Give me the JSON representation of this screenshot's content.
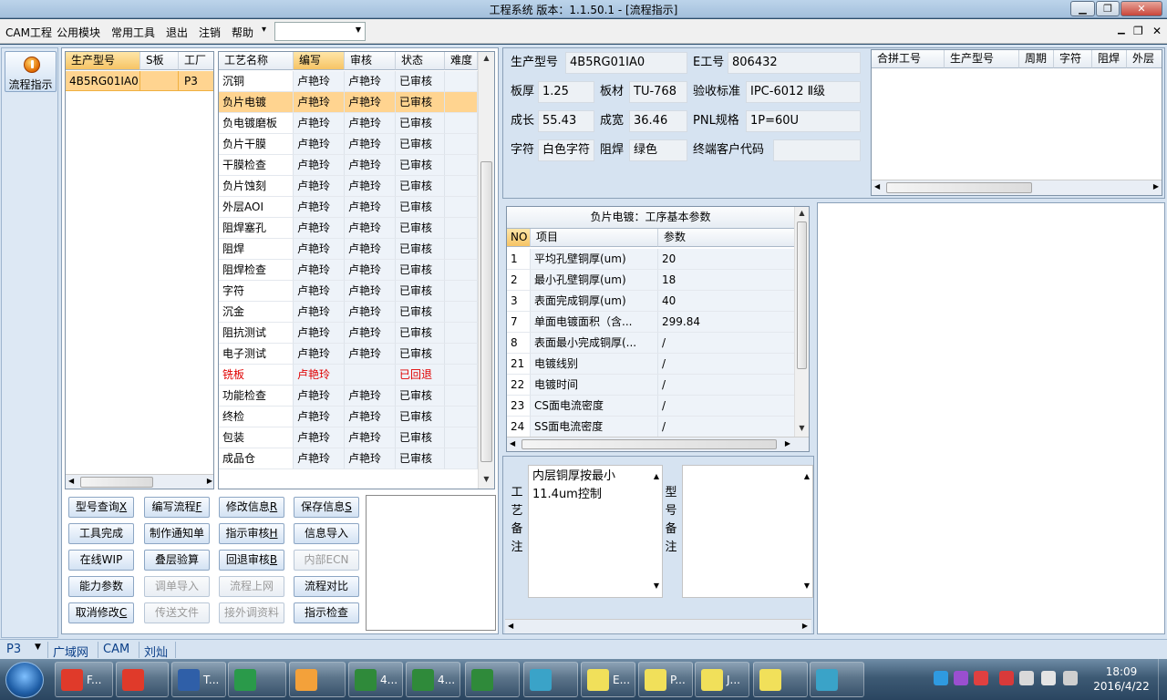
{
  "window": {
    "title": "工程系统   版本：1.1.50.1 - [流程指示]"
  },
  "menu": {
    "items": [
      "CAM工程",
      "公用模块",
      "常用工具",
      "退出",
      "注销",
      "帮助"
    ],
    "help_arrow": "▾",
    "combo_value": ""
  },
  "left_strip": {
    "flow_button": "流程指示"
  },
  "product_list": {
    "headers": [
      "生产型号",
      "S板",
      "工厂"
    ],
    "rows": [
      {
        "model": "4B5RG01IA0",
        "s": "",
        "factory": "P3"
      }
    ]
  },
  "process_table": {
    "headers": [
      "工艺名称",
      "编写",
      "审核",
      "状态",
      "难度"
    ],
    "rows": [
      {
        "name": "沉铜",
        "writer": "卢艳玲",
        "reviewer": "卢艳玲",
        "status": "已审核"
      },
      {
        "name": "负片电镀",
        "writer": "卢艳玲",
        "reviewer": "卢艳玲",
        "status": "已审核"
      },
      {
        "name": "负电镀磨板",
        "writer": "卢艳玲",
        "reviewer": "卢艳玲",
        "status": "已审核"
      },
      {
        "name": "负片干膜",
        "writer": "卢艳玲",
        "reviewer": "卢艳玲",
        "status": "已审核"
      },
      {
        "name": "干膜检查",
        "writer": "卢艳玲",
        "reviewer": "卢艳玲",
        "status": "已审核"
      },
      {
        "name": "负片蚀刻",
        "writer": "卢艳玲",
        "reviewer": "卢艳玲",
        "status": "已审核"
      },
      {
        "name": "外层AOI",
        "writer": "卢艳玲",
        "reviewer": "卢艳玲",
        "status": "已审核"
      },
      {
        "name": "阻焊塞孔",
        "writer": "卢艳玲",
        "reviewer": "卢艳玲",
        "status": "已审核"
      },
      {
        "name": "阻焊",
        "writer": "卢艳玲",
        "reviewer": "卢艳玲",
        "status": "已审核"
      },
      {
        "name": "阻焊检查",
        "writer": "卢艳玲",
        "reviewer": "卢艳玲",
        "status": "已审核"
      },
      {
        "name": "字符",
        "writer": "卢艳玲",
        "reviewer": "卢艳玲",
        "status": "已审核"
      },
      {
        "name": "沉金",
        "writer": "卢艳玲",
        "reviewer": "卢艳玲",
        "status": "已审核"
      },
      {
        "name": "阻抗测试",
        "writer": "卢艳玲",
        "reviewer": "卢艳玲",
        "status": "已审核"
      },
      {
        "name": "电子测试",
        "writer": "卢艳玲",
        "reviewer": "卢艳玲",
        "status": "已审核"
      },
      {
        "name": "铣板",
        "writer": "卢艳玲",
        "reviewer": "",
        "status": "已回退"
      },
      {
        "name": "功能检查",
        "writer": "卢艳玲",
        "reviewer": "卢艳玲",
        "status": "已审核"
      },
      {
        "name": "终检",
        "writer": "卢艳玲",
        "reviewer": "卢艳玲",
        "status": "已审核"
      },
      {
        "name": "包装",
        "writer": "卢艳玲",
        "reviewer": "卢艳玲",
        "status": "已审核"
      },
      {
        "name": "成品仓",
        "writer": "卢艳玲",
        "reviewer": "卢艳玲",
        "status": "已审核"
      }
    ]
  },
  "buttons": [
    {
      "label": "型号查询",
      "key": "X",
      "enabled": true
    },
    {
      "label": "编写流程",
      "key": "F",
      "enabled": true
    },
    {
      "label": "修改信息",
      "key": "R",
      "enabled": true
    },
    {
      "label": "保存信息",
      "key": "S",
      "enabled": true
    },
    {
      "label": "工具完成",
      "key": "",
      "enabled": true
    },
    {
      "label": "制作通知单",
      "key": "",
      "enabled": true
    },
    {
      "label": "指示审核",
      "key": "H",
      "enabled": true
    },
    {
      "label": "信息导入",
      "key": "",
      "enabled": true
    },
    {
      "label": "在线WIP",
      "key": "",
      "enabled": true
    },
    {
      "label": "叠层验算",
      "key": "",
      "enabled": true
    },
    {
      "label": "回退审核",
      "key": "B",
      "enabled": true
    },
    {
      "label": "内部ECN",
      "key": "",
      "enabled": false
    },
    {
      "label": "能力参数",
      "key": "",
      "enabled": true
    },
    {
      "label": "调单导入",
      "key": "",
      "enabled": false
    },
    {
      "label": "流程上网",
      "key": "",
      "enabled": false
    },
    {
      "label": "流程对比",
      "key": "",
      "enabled": true
    },
    {
      "label": "取消修改",
      "key": "C",
      "enabled": true
    },
    {
      "label": "传送文件",
      "key": "",
      "enabled": false
    },
    {
      "label": "接外调资料",
      "key": "",
      "enabled": false
    },
    {
      "label": "指示检查",
      "key": "",
      "enabled": true
    }
  ],
  "info": {
    "model_label": "生产型号",
    "model": "4B5RG01IA0",
    "e_label": "E工号",
    "e": "806432",
    "thickness_label": "板厚",
    "thickness": "1.25",
    "material_label": "板材",
    "material": "TU-768",
    "standard_label": "验收标准",
    "standard": "IPC-6012 Ⅱ级",
    "length_label": "成长",
    "length": "55.43",
    "width_label": "成宽",
    "width": "36.46",
    "pnl_label": "PNL规格",
    "pnl": "1P=60U",
    "char_label": "字符",
    "char": "白色字符",
    "mask_label": "阻焊",
    "mask": "绿色",
    "customer_label": "终端客户代码",
    "customer": ""
  },
  "merge_table": {
    "headers": [
      "合拼工号",
      "生产型号",
      "周期",
      "字符",
      "阻焊",
      "外层"
    ]
  },
  "param_table": {
    "title": "负片电镀：工序基本参数",
    "headers": [
      "NO",
      "项目",
      "参数"
    ],
    "rows": [
      {
        "no": "1",
        "item": "平均孔壁铜厚(um)",
        "value": "20"
      },
      {
        "no": "2",
        "item": "最小孔壁铜厚(um)",
        "value": "18"
      },
      {
        "no": "3",
        "item": "表面完成铜厚(um)",
        "value": "40"
      },
      {
        "no": "7",
        "item": "单面电镀面积（含...",
        "value": "299.84"
      },
      {
        "no": "8",
        "item": "表面最小完成铜厚(...",
        "value": "/"
      },
      {
        "no": "21",
        "item": "电镀线别",
        "value": "/"
      },
      {
        "no": "22",
        "item": "电镀时间",
        "value": "/"
      },
      {
        "no": "23",
        "item": "CS面电流密度",
        "value": "/"
      },
      {
        "no": "24",
        "item": "SS面电流密度",
        "value": "/"
      }
    ]
  },
  "remarks": {
    "process_label": "工艺备注",
    "process_text": "内层铜厚按最小11.4um控制",
    "model_label": "型号备注",
    "model_text": ""
  },
  "status": {
    "factory": "P3",
    "items": [
      "广域网",
      "CAM",
      "刘灿"
    ]
  },
  "taskbar": {
    "clock_time": "18:09",
    "clock_date": "2016/4/22",
    "items": [
      "F...",
      "",
      "T...",
      "",
      "",
      "4...",
      "4...",
      "",
      "",
      "E...",
      "P...",
      "J...",
      "",
      ""
    ]
  }
}
